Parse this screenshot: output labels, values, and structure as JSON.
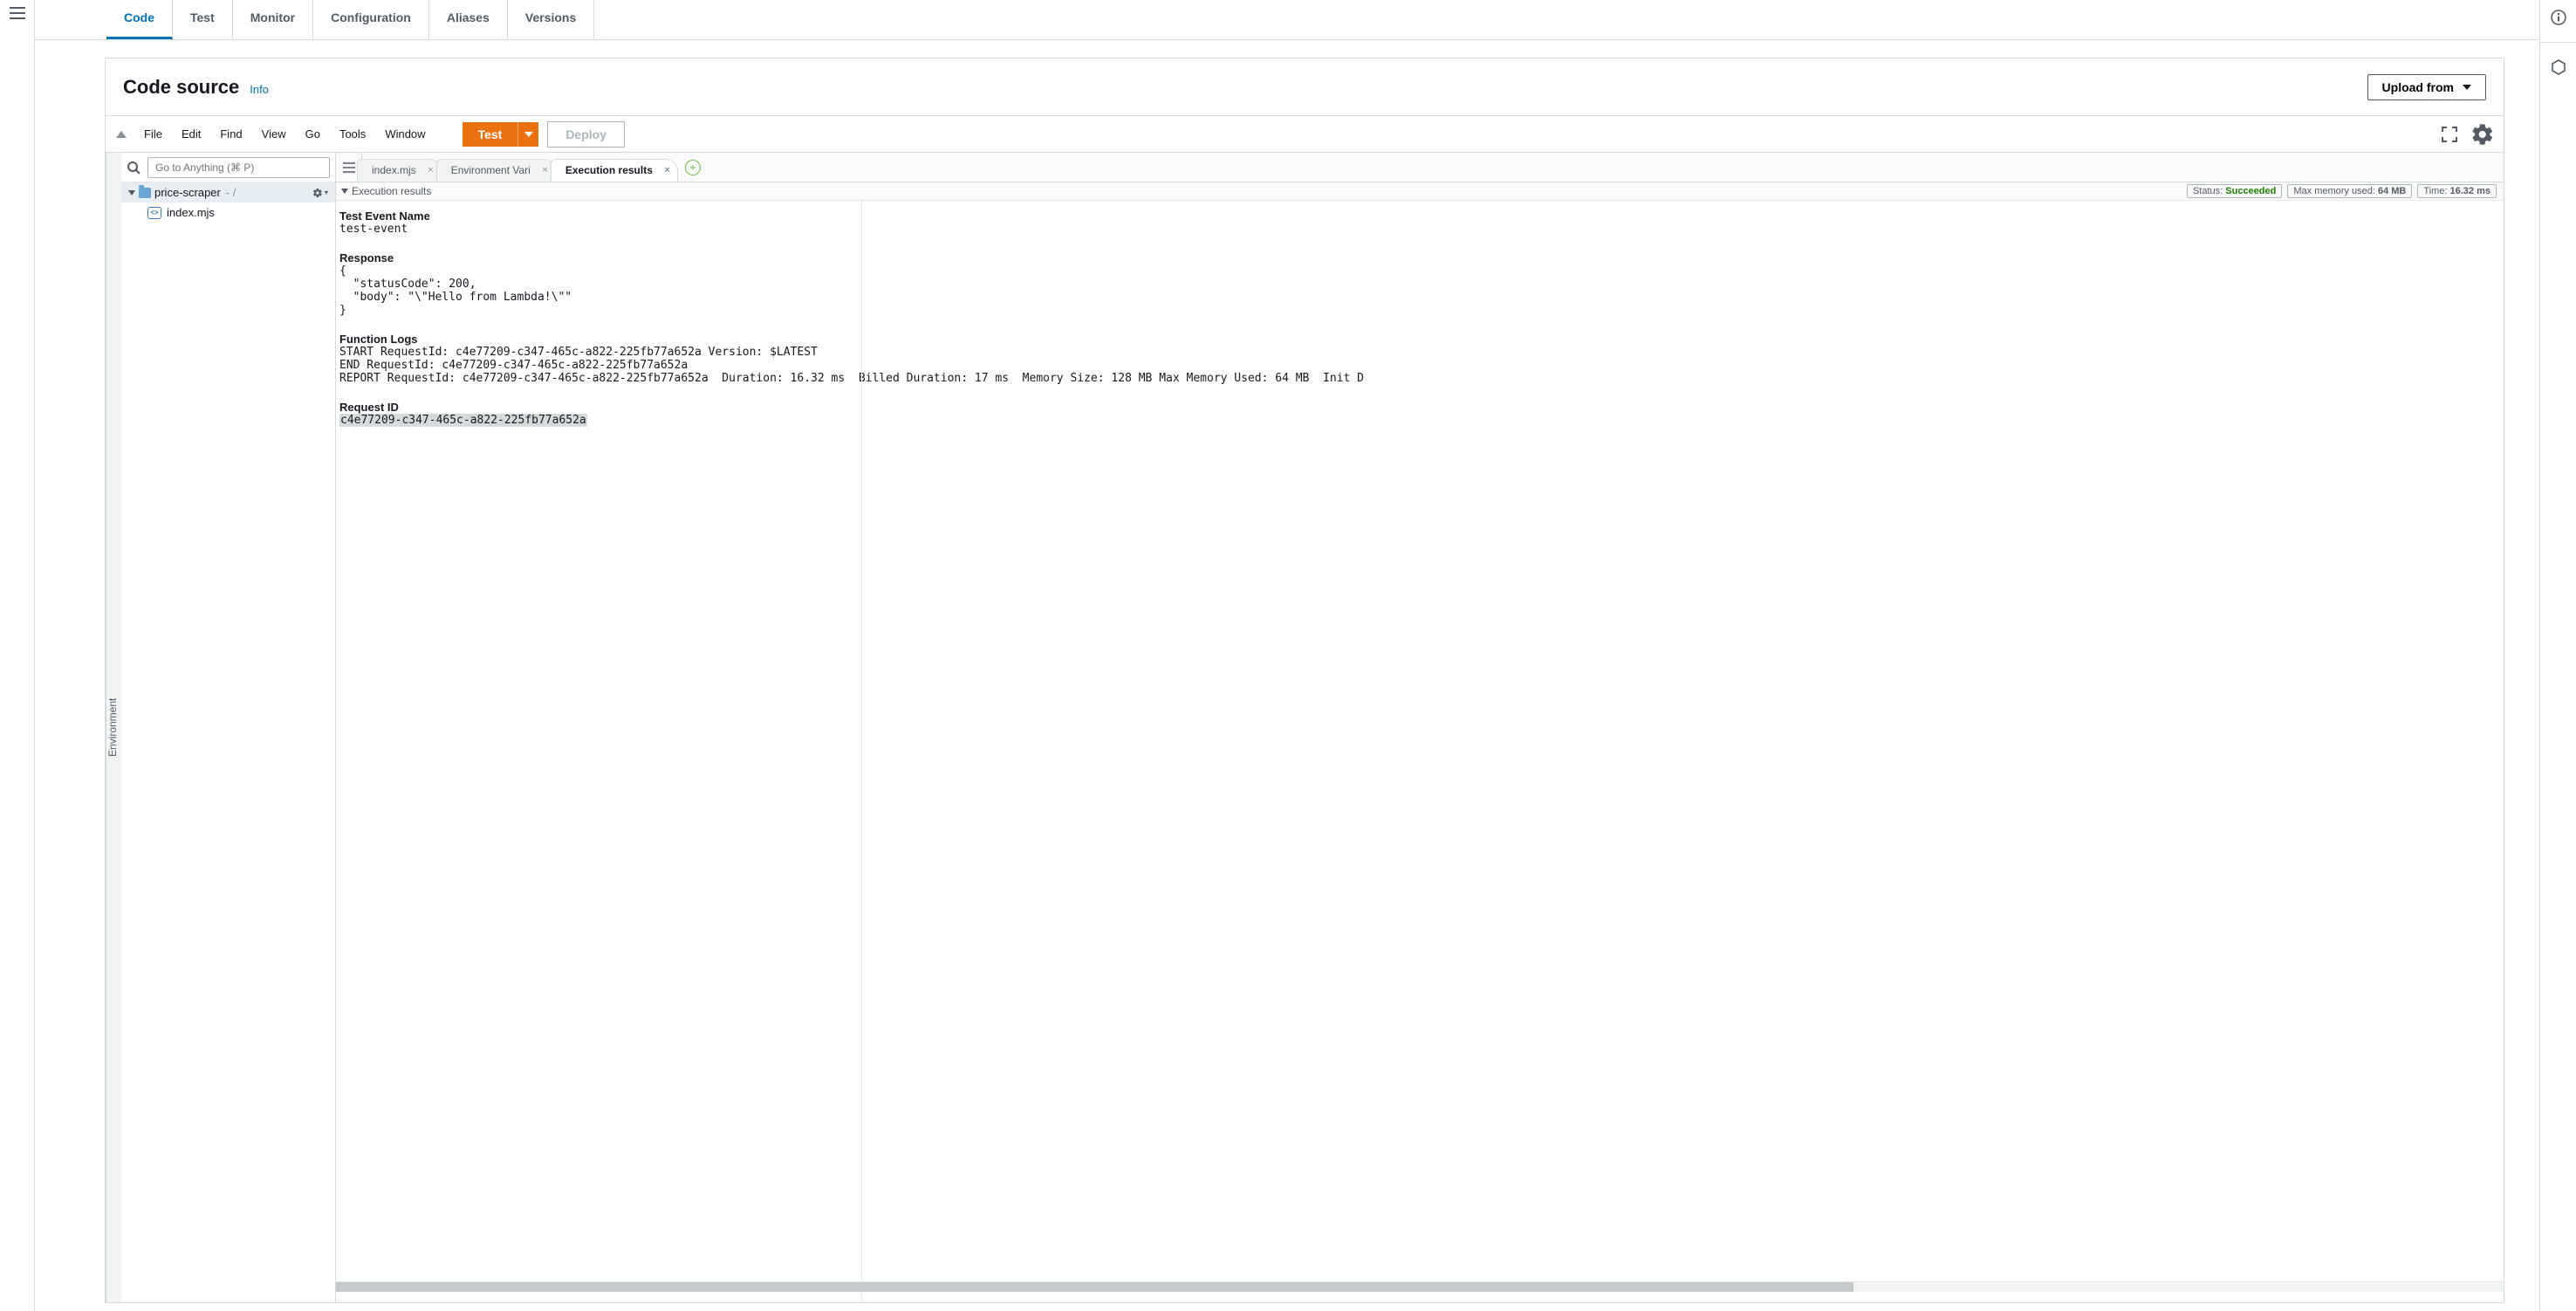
{
  "nav": {
    "tabs": [
      "Code",
      "Test",
      "Monitor",
      "Configuration",
      "Aliases",
      "Versions"
    ],
    "active": "Code"
  },
  "card": {
    "title": "Code source",
    "info": "Info",
    "upload": "Upload from"
  },
  "menubar": {
    "items": [
      "File",
      "Edit",
      "Find",
      "View",
      "Go",
      "Tools",
      "Window"
    ],
    "test": "Test",
    "deploy": "Deploy"
  },
  "filetree": {
    "env_label": "Environment",
    "goto_placeholder": "Go to Anything (⌘ P)",
    "root": "price-scraper",
    "root_suffix": "- /",
    "child": "index.mjs"
  },
  "editor_tabs": {
    "t1": "index.mjs",
    "t2": "Environment Vari",
    "t3": "Execution results"
  },
  "results": {
    "header_label": "Execution results",
    "status_label": "Status: ",
    "status_value": "Succeeded",
    "mem_label": "Max memory used: ",
    "mem_value": "64 MB",
    "time_label": "Time: ",
    "time_value": "16.32 ms",
    "test_event_label": "Test Event Name",
    "test_event_value": "test-event",
    "response_label": "Response",
    "response_body": "{\n  \"statusCode\": 200,\n  \"body\": \"\\\"Hello from Lambda!\\\"\"\n}",
    "logs_label": "Function Logs",
    "logs_body": "START RequestId: c4e77209-c347-465c-a822-225fb77a652a Version: $LATEST\nEND RequestId: c4e77209-c347-465c-a822-225fb77a652a\nREPORT RequestId: c4e77209-c347-465c-a822-225fb77a652a  Duration: 16.32 ms  Billed Duration: 17 ms  Memory Size: 128 MB Max Memory Used: 64 MB  Init D",
    "reqid_label": "Request ID",
    "reqid_value": "c4e77209-c347-465c-a822-225fb77a652a"
  }
}
